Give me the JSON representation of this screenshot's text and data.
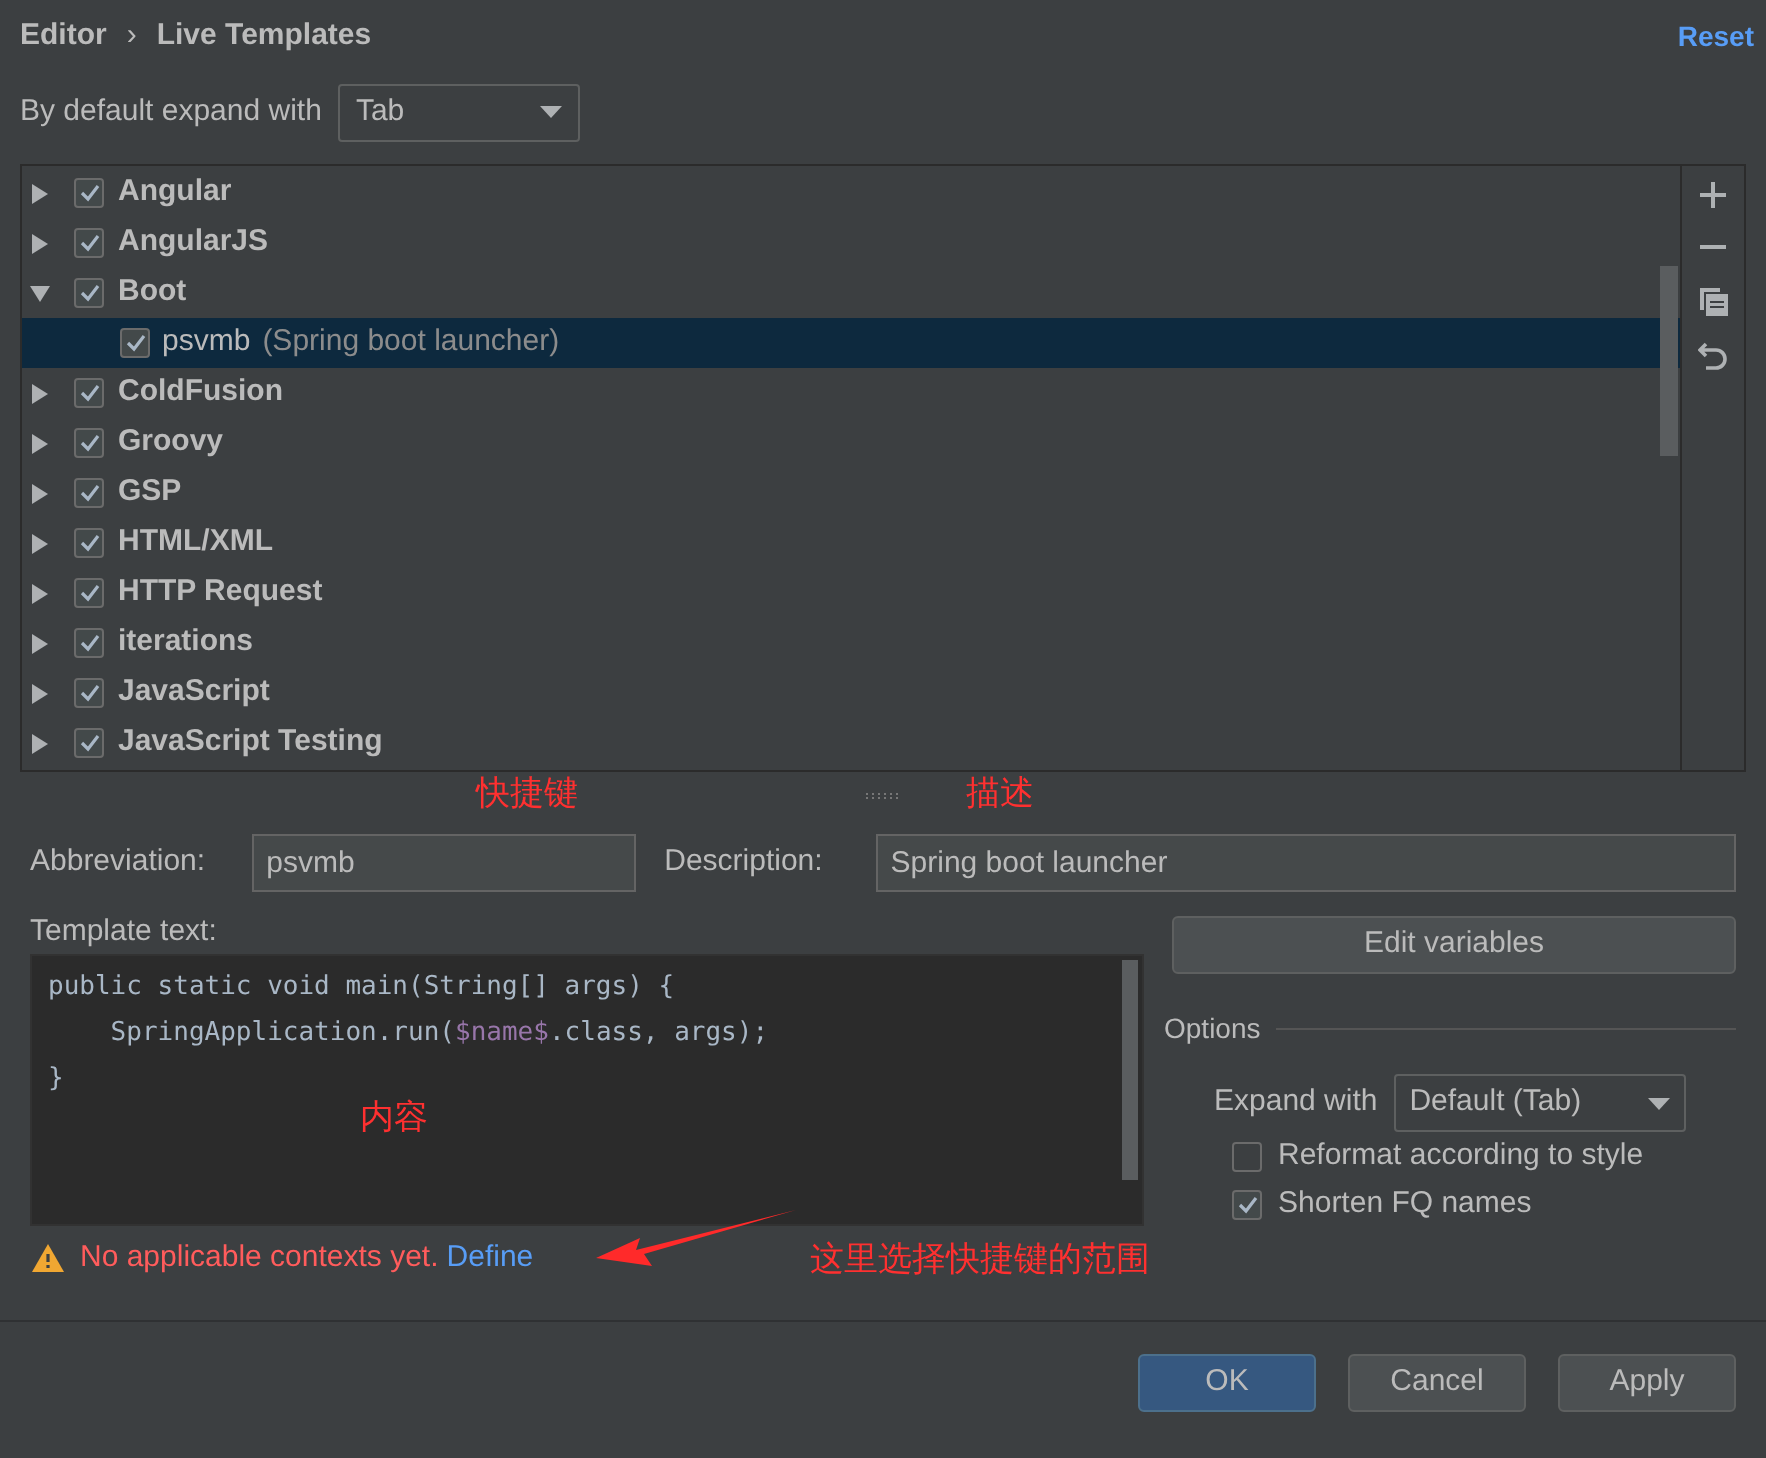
{
  "breadcrumb": {
    "parent": "Editor",
    "separator": "›",
    "current": "Live Templates"
  },
  "reset": "Reset",
  "expand_default": {
    "label": "By default expand with",
    "value": "Tab"
  },
  "tree": [
    {
      "label": "Angular",
      "checked": true,
      "expanded": false,
      "selected": false
    },
    {
      "label": "AngularJS",
      "checked": true,
      "expanded": false,
      "selected": false
    },
    {
      "label": "Boot",
      "checked": true,
      "expanded": true,
      "selected": false,
      "children": [
        {
          "label": "psvmb",
          "description": "(Spring boot launcher)",
          "checked": true,
          "selected": true
        }
      ]
    },
    {
      "label": "ColdFusion",
      "checked": true,
      "expanded": false,
      "selected": false
    },
    {
      "label": "Groovy",
      "checked": true,
      "expanded": false,
      "selected": false
    },
    {
      "label": "GSP",
      "checked": true,
      "expanded": false,
      "selected": false
    },
    {
      "label": "HTML/XML",
      "checked": true,
      "expanded": false,
      "selected": false
    },
    {
      "label": "HTTP Request",
      "checked": true,
      "expanded": false,
      "selected": false
    },
    {
      "label": "iterations",
      "checked": true,
      "expanded": false,
      "selected": false
    },
    {
      "label": "JavaScript",
      "checked": true,
      "expanded": false,
      "selected": false
    },
    {
      "label": "JavaScript Testing",
      "checked": true,
      "expanded": false,
      "selected": false
    }
  ],
  "abbreviation": {
    "label": "Abbreviation:",
    "value": "psvmb"
  },
  "description": {
    "label": "Description:",
    "value": "Spring boot launcher"
  },
  "template_text": {
    "label": "Template text:",
    "lines": [
      [
        {
          "kind": "text",
          "text": "public static void main(String[] args) {"
        }
      ],
      [
        {
          "kind": "text",
          "text": "    SpringApplication.run("
        },
        {
          "kind": "variable",
          "text": "$name$"
        },
        {
          "kind": "text",
          "text": ".class, args);"
        }
      ],
      [
        {
          "kind": "text",
          "text": "}"
        }
      ]
    ]
  },
  "edit_variables": "Edit variables",
  "options": {
    "title": "Options",
    "expand_with": {
      "label": "Expand with",
      "value": "Default (Tab)"
    },
    "checkboxes": [
      {
        "label": "Reformat according to style",
        "checked": false
      },
      {
        "label": "Shorten FQ names",
        "checked": true
      }
    ]
  },
  "warning": {
    "text": "No applicable contexts yet.",
    "link": "Define"
  },
  "annotations": [
    {
      "text": "快捷键"
    },
    {
      "text": "描述"
    },
    {
      "text": "内容"
    },
    {
      "text": "这里选择快捷键的范围"
    }
  ],
  "buttons": [
    {
      "label": "OK",
      "default": true
    },
    {
      "label": "Cancel",
      "default": false
    },
    {
      "label": "Apply",
      "default": false
    }
  ]
}
